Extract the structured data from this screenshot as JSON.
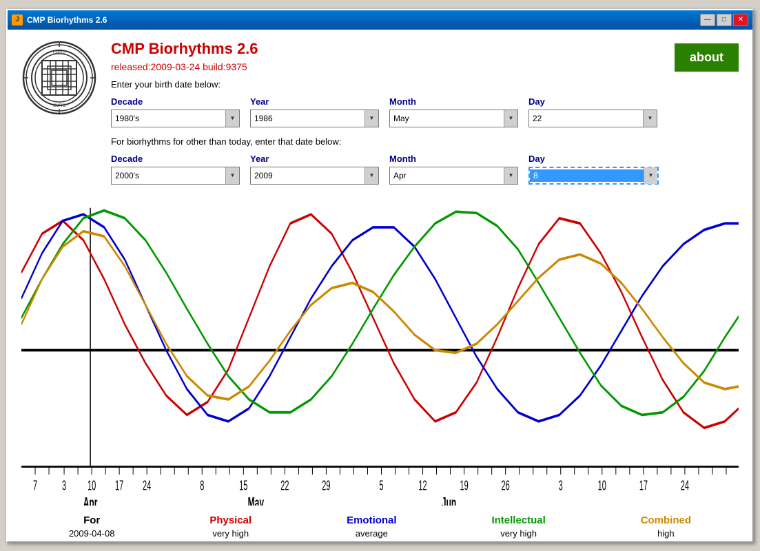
{
  "window": {
    "title": "CMP Biorhythms 2.6",
    "icon": "J"
  },
  "titlebar_buttons": {
    "minimize": "—",
    "maximize": "□",
    "close": "✕"
  },
  "app": {
    "title": "CMP Biorhythms 2.6",
    "subtitle": "released:2009-03-24 build:9375",
    "about_label": "about"
  },
  "birth_date": {
    "label": "Enter your birth date below:",
    "decade_label": "Decade",
    "year_label": "Year",
    "month_label": "Month",
    "day_label": "Day",
    "decade_value": "1980's",
    "year_value": "1986",
    "month_value": "May",
    "day_value": "22"
  },
  "other_date": {
    "label": "For biorhythms for other than today, enter that date below:",
    "decade_label": "Decade",
    "year_label": "Year",
    "month_label": "Month",
    "day_label": "Day",
    "decade_value": "2000's",
    "year_value": "2009",
    "month_value": "Apr",
    "day_value": "8"
  },
  "legend": {
    "for_label": "For",
    "physical_label": "Physical",
    "emotional_label": "Emotional",
    "intellectual_label": "Intellectual",
    "combined_label": "Combined",
    "for_value": "2009-04-08",
    "physical_value": "very high",
    "emotional_value": "average",
    "intellectual_value": "very high",
    "combined_value": "high",
    "physical_color": "#ff0000",
    "emotional_color": "#0000ff",
    "intellectual_color": "#00aa00",
    "combined_color": "#cc8800",
    "for_color": "#000000"
  },
  "chart": {
    "x_labels": [
      "7",
      "",
      "3",
      "",
      "10",
      "",
      "17",
      "",
      "24",
      "",
      "",
      "8",
      "",
      "15",
      "",
      "22",
      "",
      "29",
      "",
      "5",
      "",
      "12",
      "",
      "19",
      "",
      "26",
      "",
      "3",
      "",
      "10",
      "",
      "17",
      "",
      "24",
      ""
    ],
    "month_labels": [
      "Apr",
      "May",
      "Jun"
    ],
    "zero_line_y": 0.5
  }
}
